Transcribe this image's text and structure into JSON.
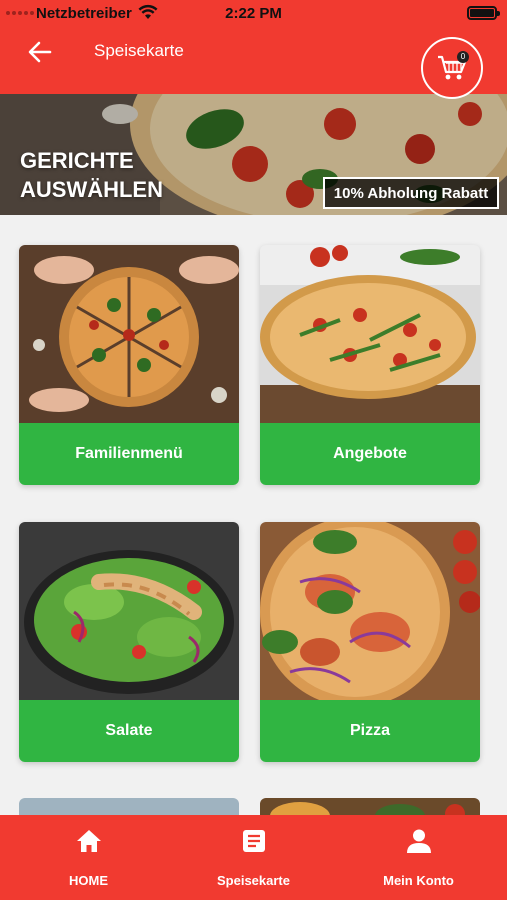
{
  "status_bar": {
    "carrier": "Netzbetreiber",
    "time": "2:22 PM"
  },
  "header": {
    "title": "Speisekarte",
    "back_icon": "arrow-left-icon",
    "cart_icon": "shopping-cart-icon",
    "cart_count": "0"
  },
  "hero": {
    "title_line1": "GERICHTE",
    "title_line2": "AUSWÄHLEN",
    "badge": "10% Abholung Rabatt"
  },
  "categories": [
    {
      "label": "Familienmenü"
    },
    {
      "label": "Angebote"
    },
    {
      "label": "Salate"
    },
    {
      "label": "Pizza"
    }
  ],
  "bottom_nav": {
    "items": [
      {
        "label": "HOME",
        "icon": "home-icon"
      },
      {
        "label": "Speisekarte",
        "icon": "menu-list-icon"
      },
      {
        "label": "Mein Konto",
        "icon": "user-icon"
      }
    ]
  },
  "colors": {
    "primary": "#f13a30",
    "accent_green": "#30b542",
    "background": "#f1f1f1"
  }
}
